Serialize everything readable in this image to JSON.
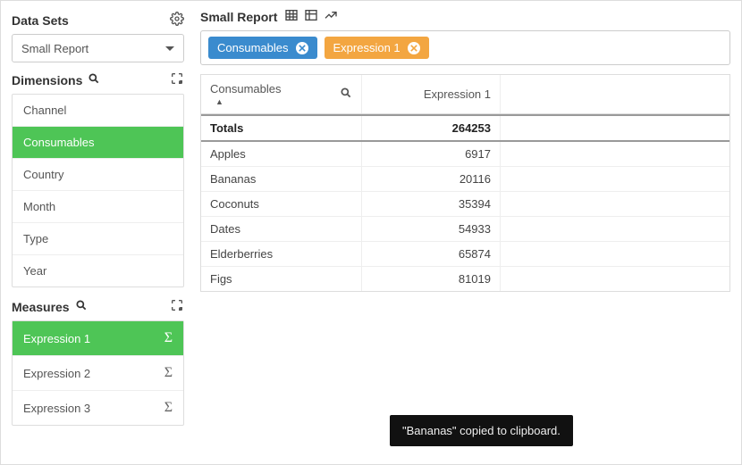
{
  "sidebar": {
    "datasets": {
      "title": "Data Sets",
      "selected": "Small Report"
    },
    "dimensions": {
      "title": "Dimensions",
      "items": [
        {
          "label": "Channel",
          "active": false
        },
        {
          "label": "Consumables",
          "active": true
        },
        {
          "label": "Country",
          "active": false
        },
        {
          "label": "Month",
          "active": false
        },
        {
          "label": "Type",
          "active": false
        },
        {
          "label": "Year",
          "active": false
        }
      ]
    },
    "measures": {
      "title": "Measures",
      "items": [
        {
          "label": "Expression 1",
          "active": true
        },
        {
          "label": "Expression 2",
          "active": false
        },
        {
          "label": "Expression 3",
          "active": false
        }
      ]
    }
  },
  "main": {
    "title": "Small Report",
    "chips": [
      {
        "label": "Consumables",
        "color": "blue"
      },
      {
        "label": "Expression 1",
        "color": "orange"
      }
    ],
    "table": {
      "columns": [
        "Consumables",
        "Expression 1"
      ],
      "totals_label": "Totals",
      "totals_value": "264253",
      "rows": [
        {
          "label": "Apples",
          "value": "6917"
        },
        {
          "label": "Bananas",
          "value": "20116"
        },
        {
          "label": "Coconuts",
          "value": "35394"
        },
        {
          "label": "Dates",
          "value": "54933"
        },
        {
          "label": "Elderberries",
          "value": "65874"
        },
        {
          "label": "Figs",
          "value": "81019"
        }
      ]
    }
  },
  "toast": {
    "message": "\"Bananas\" copied to clipboard."
  }
}
